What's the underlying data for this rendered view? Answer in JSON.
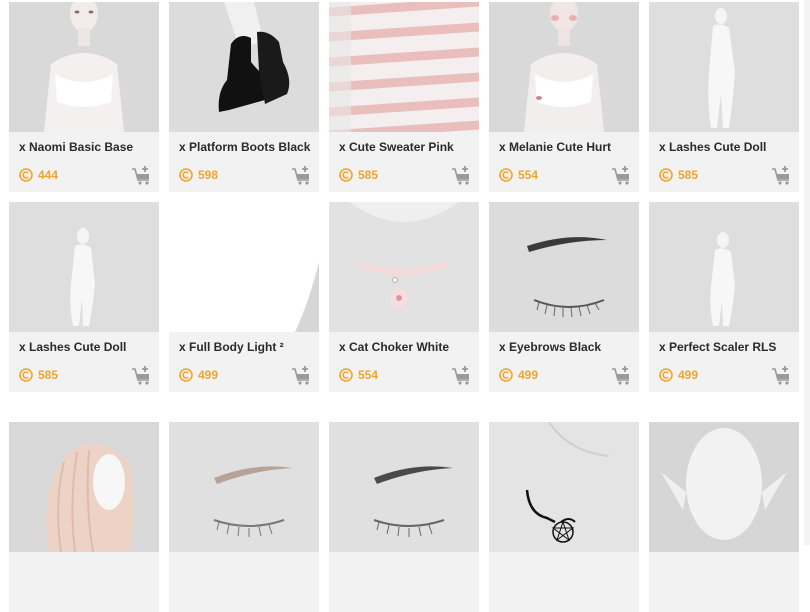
{
  "products": [
    {
      "title": "x Naomi Basic Base",
      "price": "444",
      "image": "female-body-thumbnail"
    },
    {
      "title": "x Platform Boots Black",
      "price": "598",
      "image": "black-boots-thumbnail"
    },
    {
      "title": "x Cute Sweater Pink",
      "price": "585",
      "image": "striped-sweater-thumbnail"
    },
    {
      "title": "x Melanie Cute Hurt",
      "price": "554",
      "image": "female-body-thumbnail"
    },
    {
      "title": "x Lashes Cute Doll",
      "price": "585",
      "image": "white-figure-thumbnail"
    },
    {
      "title": "x Lashes Cute Doll",
      "price": "585",
      "image": "white-figure-thumbnail"
    },
    {
      "title": "x Full Body Light ²",
      "price": "499",
      "image": "white-skin-thumbnail"
    },
    {
      "title": "x Cat Choker White",
      "price": "554",
      "image": "choker-thumbnail"
    },
    {
      "title": "x Eyebrows Black",
      "price": "499",
      "image": "eyebrow-closed-eye-thumbnail"
    },
    {
      "title": "x Perfect Scaler RLS",
      "price": "499",
      "image": "white-figure-thumbnail"
    },
    {
      "title": "",
      "price": "",
      "image": "pink-hair-thumbnail"
    },
    {
      "title": "",
      "price": "",
      "image": "light-eyebrow-thumbnail"
    },
    {
      "title": "",
      "price": "",
      "image": "dark-eyebrow-thumbnail"
    },
    {
      "title": "",
      "price": "",
      "image": "pentagram-necklace-thumbnail"
    },
    {
      "title": "",
      "price": "",
      "image": "elf-ears-head-thumbnail"
    }
  ],
  "colors": {
    "price": "#f0a52b",
    "card_bg": "#f2f2f2",
    "title": "#2a2a2a"
  },
  "icons": {
    "currency": "credits-coin-icon",
    "cart": "add-to-cart-icon"
  }
}
